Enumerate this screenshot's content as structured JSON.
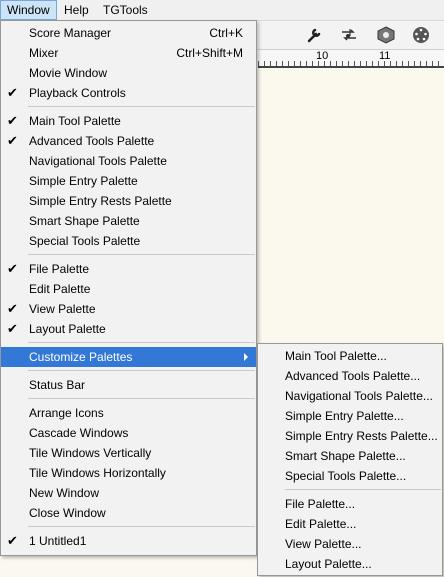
{
  "menubar": {
    "items": [
      {
        "label": "Window",
        "active": true
      },
      {
        "label": "Help",
        "active": false
      },
      {
        "label": "TGTools",
        "active": false
      }
    ]
  },
  "ruler": {
    "labels": [
      "10",
      "11"
    ]
  },
  "window_menu": {
    "groups": [
      [
        {
          "label": "Score Manager",
          "shortcut": "Ctrl+K",
          "checked": false
        },
        {
          "label": "Mixer",
          "shortcut": "Ctrl+Shift+M",
          "checked": false
        },
        {
          "label": "Movie Window",
          "shortcut": "",
          "checked": false
        },
        {
          "label": "Playback Controls",
          "shortcut": "",
          "checked": true
        }
      ],
      [
        {
          "label": "Main Tool Palette",
          "checked": true
        },
        {
          "label": "Advanced Tools Palette",
          "checked": true
        },
        {
          "label": "Navigational Tools Palette",
          "checked": false
        },
        {
          "label": "Simple Entry Palette",
          "checked": false
        },
        {
          "label": "Simple Entry Rests Palette",
          "checked": false
        },
        {
          "label": "Smart Shape Palette",
          "checked": false
        },
        {
          "label": "Special Tools Palette",
          "checked": false
        }
      ],
      [
        {
          "label": "File Palette",
          "checked": true
        },
        {
          "label": "Edit Palette",
          "checked": false
        },
        {
          "label": "View Palette",
          "checked": true
        },
        {
          "label": "Layout Palette",
          "checked": true
        }
      ],
      [
        {
          "label": "Customize Palettes",
          "checked": false,
          "highlighted": true,
          "submenu": true
        }
      ],
      [
        {
          "label": "Status Bar",
          "checked": false
        }
      ],
      [
        {
          "label": "Arrange Icons",
          "checked": false
        },
        {
          "label": "Cascade Windows",
          "checked": false
        },
        {
          "label": "Tile Windows Vertically",
          "checked": false
        },
        {
          "label": "Tile Windows Horizontally",
          "checked": false
        },
        {
          "label": "New Window",
          "checked": false
        },
        {
          "label": "Close Window",
          "checked": false
        }
      ],
      [
        {
          "label": "1 Untitled1",
          "checked": true
        }
      ]
    ]
  },
  "customize_submenu": {
    "groups": [
      [
        {
          "label": "Main Tool Palette..."
        },
        {
          "label": "Advanced Tools Palette..."
        },
        {
          "label": "Navigational Tools Palette..."
        },
        {
          "label": "Simple Entry Palette..."
        },
        {
          "label": "Simple Entry Rests Palette..."
        },
        {
          "label": "Smart Shape Palette..."
        },
        {
          "label": "Special Tools Palette..."
        }
      ],
      [
        {
          "label": "File Palette..."
        },
        {
          "label": "Edit Palette..."
        },
        {
          "label": "View Palette..."
        },
        {
          "label": "Layout Palette..."
        }
      ]
    ]
  },
  "toolbar": {
    "icons": [
      "wrench-icon",
      "music-repeat-icon",
      "speaker-cube-icon",
      "midi-icon"
    ]
  },
  "colors": {
    "highlight": "#3378d6",
    "menubar_active": "#cce4f7"
  },
  "check_glyph": "✔"
}
